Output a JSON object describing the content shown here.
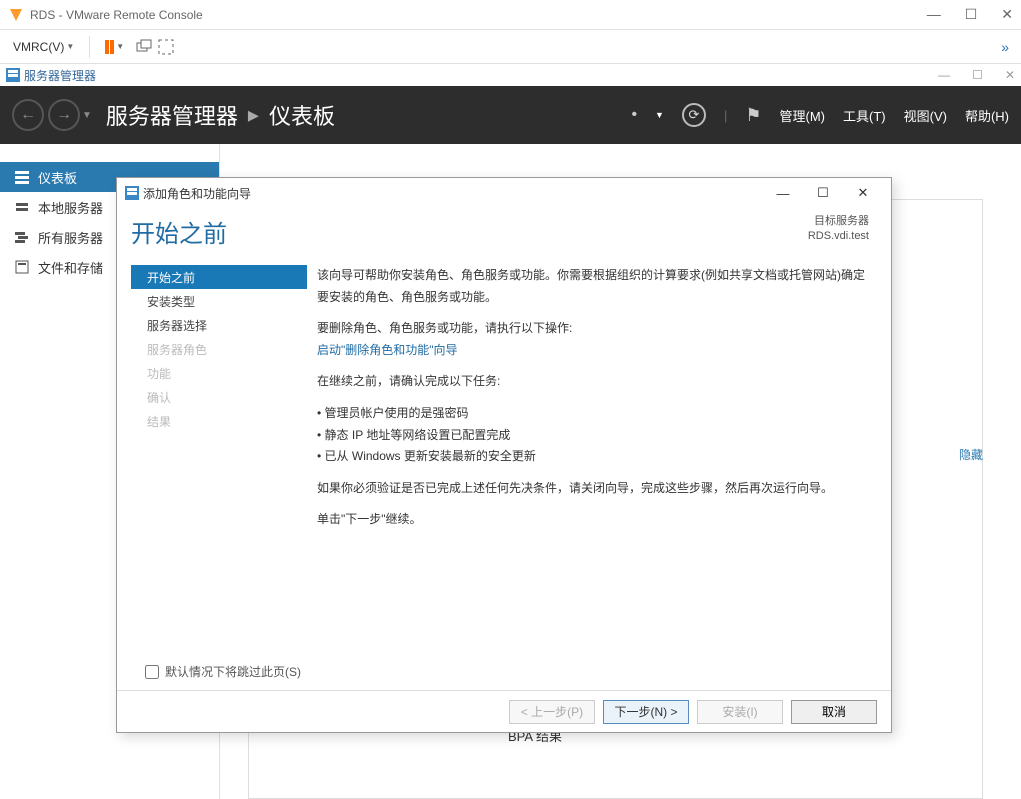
{
  "vmware": {
    "title": "RDS - VMware Remote Console",
    "menu_label": "VMRC(V)",
    "chevrons": "»"
  },
  "sm_chrome": {
    "title": "服务器管理器"
  },
  "dark_header": {
    "breadcrumb_root": "服务器管理器",
    "breadcrumb_sep": "▸",
    "breadcrumb_leaf": "仪表板",
    "menus": {
      "manage": "管理(M)",
      "tools": "工具(T)",
      "view": "视图(V)",
      "help": "帮助(H)"
    }
  },
  "sidebar": {
    "items": [
      "仪表板",
      "本地服务器",
      "所有服务器",
      "文件和存储"
    ]
  },
  "main": {
    "hide": "隐藏",
    "bpa": "BPA 结果"
  },
  "wizard": {
    "title": "添加角色和功能向导",
    "heading": "开始之前",
    "target_label": "目标服务器",
    "target_value": "RDS.vdi.test",
    "steps": [
      "开始之前",
      "安装类型",
      "服务器选择",
      "服务器角色",
      "功能",
      "确认",
      "结果"
    ],
    "content": {
      "p1": "该向导可帮助你安装角色、角色服务或功能。你需要根据组织的计算要求(例如共享文档或托管网站)确定要安装的角色、角色服务或功能。",
      "p2a": "要删除角色、角色服务或功能，请执行以下操作:",
      "p2b": "启动\"删除角色和功能\"向导",
      "p3": "在继续之前，请确认完成以下任务:",
      "b1": "管理员帐户使用的是强密码",
      "b2": "静态 IP 地址等网络设置已配置完成",
      "b3": "已从 Windows 更新安装最新的安全更新",
      "p4": "如果你必须验证是否已完成上述任何先决条件，请关闭向导，完成这些步骤，然后再次运行向导。",
      "p5": "单击\"下一步\"继续。"
    },
    "skip_label": "默认情况下将跳过此页(S)",
    "buttons": {
      "prev": "< 上一步(P)",
      "next": "下一步(N) >",
      "install": "安装(I)",
      "cancel": "取消"
    }
  }
}
